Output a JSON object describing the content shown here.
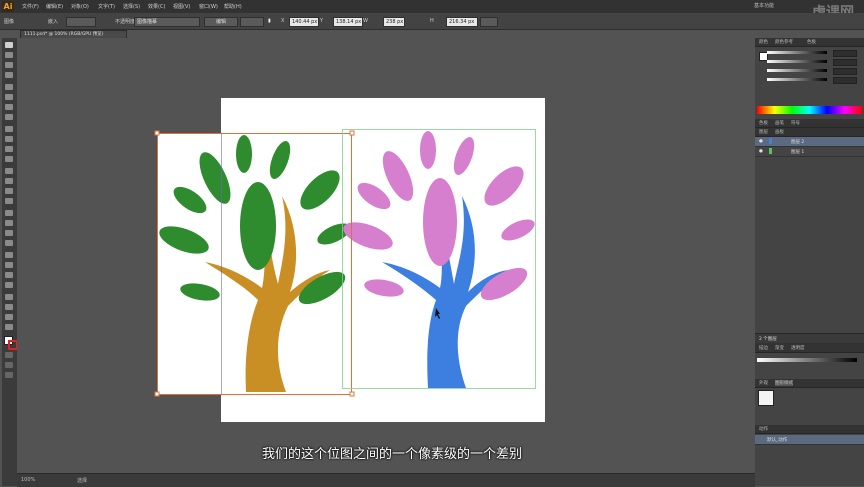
{
  "app": {
    "logo": "Ai",
    "workspace": "基本功能"
  },
  "menu": [
    "文件(F)",
    "编辑(E)",
    "对象(O)",
    "文字(T)",
    "选择(S)",
    "效果(C)",
    "视图(V)",
    "窗口(W)",
    "帮助(H)"
  ],
  "controlbar": {
    "label": "图像",
    "link_text": "嵌入",
    "opacity_label": "不透明度",
    "style_text": "图像描摹",
    "edit_button": "编辑",
    "x_value": "140.44 px",
    "y_value": "138.14 px",
    "w_value": "238 px",
    "h_value": "216.34 px"
  },
  "document_tab": "1111.psd* @ 100% (RGB/GPU 预览)",
  "subtitle": "我们的这个位图之间的一个像素级的一个差别",
  "watermark": "虎课网",
  "statusbar": {
    "zoom": "100%",
    "tool": "选择"
  },
  "panels": {
    "color_tabs": [
      "颜色",
      "颜色参考",
      "色板"
    ],
    "swatch_tabs": [
      "色板",
      "画笔",
      "符号"
    ],
    "layers_tabs": [
      "图层",
      "画板"
    ],
    "layers": [
      {
        "name": "图层 2",
        "color": "#4a7bd6"
      },
      {
        "name": "图层 1",
        "color": "#58c25a"
      }
    ],
    "layers_footer": "2 个图层",
    "transparency_tabs": [
      "描边",
      "渐变",
      "透明度"
    ],
    "appearance_tabs": [
      "外观",
      "图形样式"
    ],
    "actions_tabs": [
      "动作"
    ],
    "actions_row": "默认_动作"
  },
  "colors": {
    "green_leaf": "#2e8b2e",
    "pink_leaf": "#d77fcf",
    "trunk_gold": "#c98f24",
    "trunk_blue": "#3d7fe0"
  }
}
